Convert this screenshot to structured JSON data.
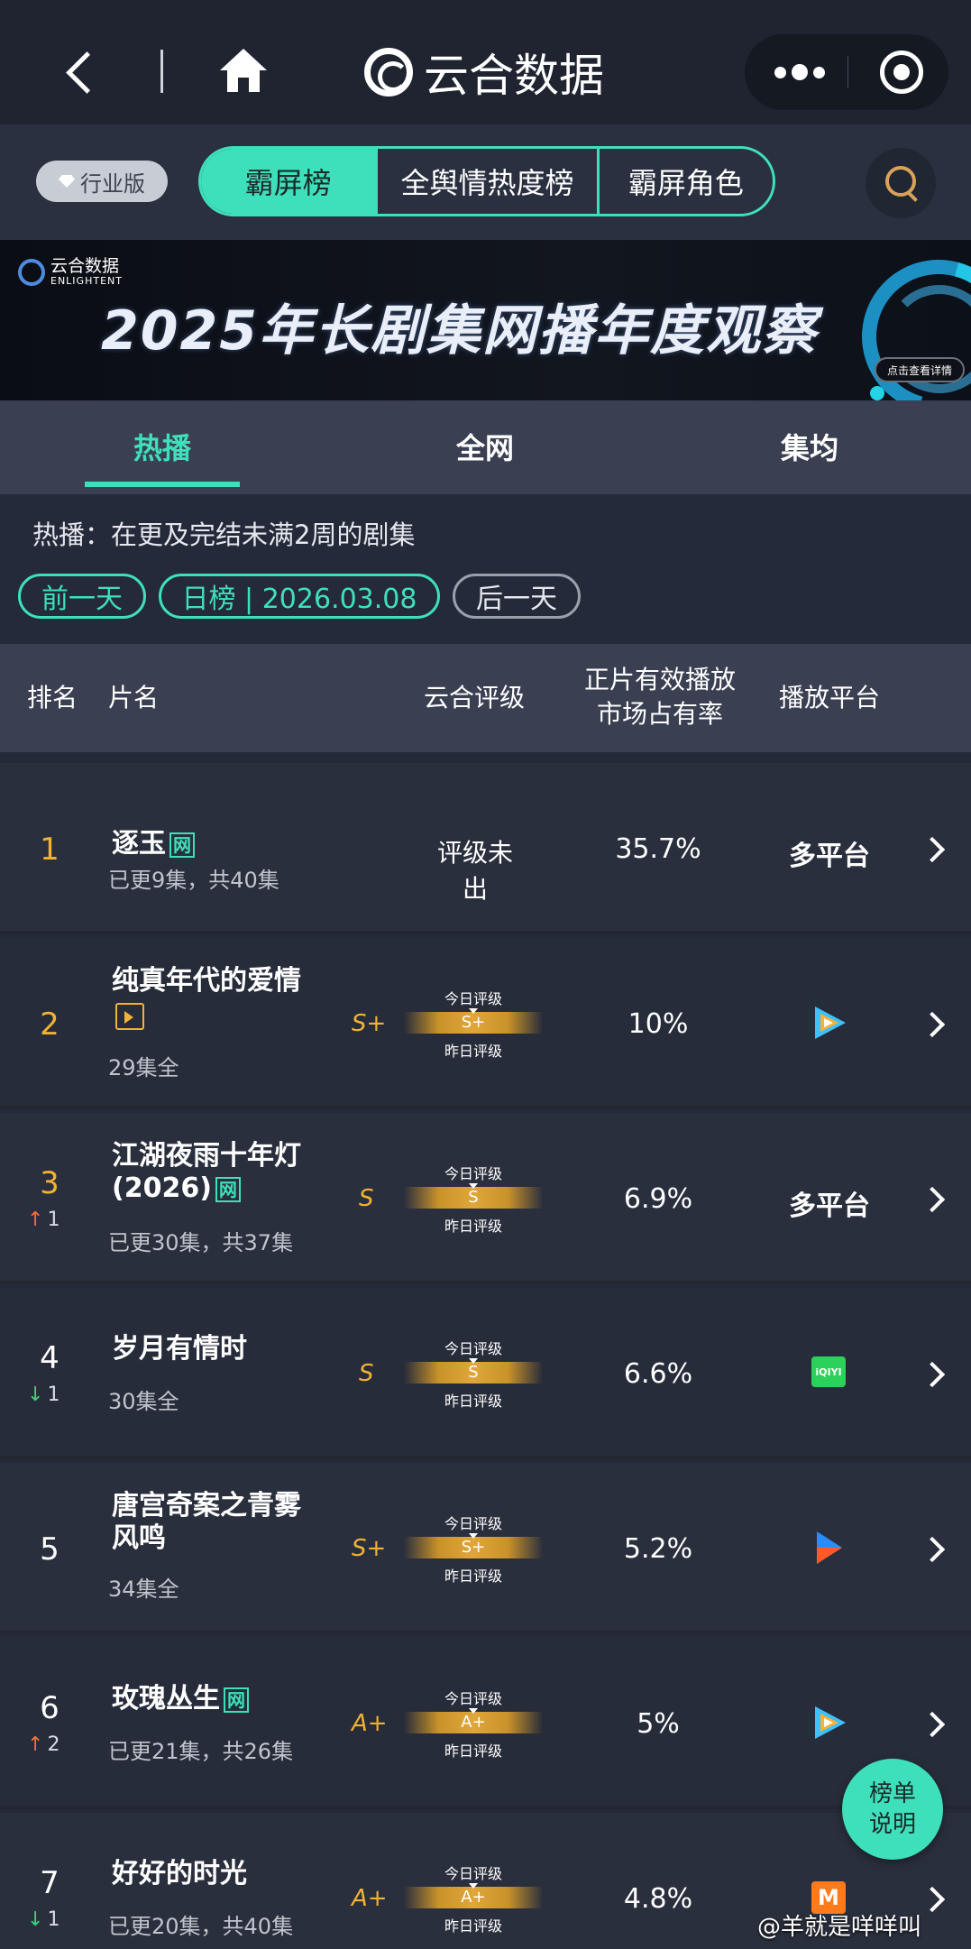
{
  "header": {
    "brand": "云合数据"
  },
  "segment": {
    "industry": "行业版",
    "options": [
      "霸屏榜",
      "全舆情热度榜",
      "霸屏角色"
    ]
  },
  "banner": {
    "logo_text": "云合数据",
    "logo_sub": "ENLIGHTENT",
    "title": "2025年长剧集网播年度观察",
    "button": "点击查看详情"
  },
  "tabs": [
    "热播",
    "全网",
    "集均"
  ],
  "description": "热播：在更及完结未满2周的剧集",
  "date": {
    "prev": "前一天",
    "current": "日榜 | 2026.03.08",
    "next": "后一天"
  },
  "table": {
    "headers": {
      "rank": "排名",
      "name": "片名",
      "grade": "云合评级",
      "share_line1": "正片有效播放",
      "share_line2": "市场占有率",
      "platform": "播放平台"
    },
    "grade_today": "今日评级",
    "grade_yesterday": "昨日评级",
    "rows": [
      {
        "rank": "1",
        "title": "逐玉",
        "tag": "网",
        "sub": "已更9集，共40集",
        "grade_text": "评级未出",
        "share": "35.7%",
        "platform": "多平台"
      },
      {
        "rank": "2",
        "title": "纯真年代的爱情",
        "tag_icon": "play-tag-icon",
        "sub": "29集全",
        "grade": "S+",
        "share": "10%",
        "platform_icon": "tencent-video-icon"
      },
      {
        "rank": "3",
        "title_line1": "江湖夜雨十年灯",
        "title_line2": "(2026)",
        "tag": "网",
        "trend": "1",
        "trend_dir": "up",
        "sub": "已更30集，共37集",
        "grade": "S",
        "share": "6.9%",
        "platform": "多平台"
      },
      {
        "rank": "4",
        "title": "岁月有情时",
        "trend": "1",
        "trend_dir": "down",
        "sub": "30集全",
        "grade": "S",
        "share": "6.6%",
        "platform_icon": "iqiyi-icon",
        "platform_icon_text": "iQIYI"
      },
      {
        "rank": "5",
        "title_line1": "唐宫奇案之青雾",
        "title_line2": "风鸣",
        "sub": "34集全",
        "grade": "S+",
        "share": "5.2%",
        "platform_icon": "youku-icon"
      },
      {
        "rank": "6",
        "title": "玫瑰丛生",
        "tag": "网",
        "trend": "2",
        "trend_dir": "up",
        "sub": "已更21集，共26集",
        "grade": "A+",
        "share": "5%",
        "platform_icon": "tencent-video-icon"
      },
      {
        "rank": "7",
        "title": "好好的时光",
        "trend": "1",
        "trend_dir": "down",
        "sub": "已更20集，共40集",
        "grade": "A+",
        "share": "4.8%",
        "platform_icon": "mango-tv-icon",
        "platform_icon_text": "M"
      }
    ]
  },
  "float_button": [
    "榜单",
    "说明"
  ],
  "credit": "@羊就是咩咩叫",
  "colors": {
    "accent": "#3ee0bb",
    "gold": "#f2b233",
    "up": "#ff6a3d",
    "down": "#3ed17a",
    "background": "#242a39"
  }
}
